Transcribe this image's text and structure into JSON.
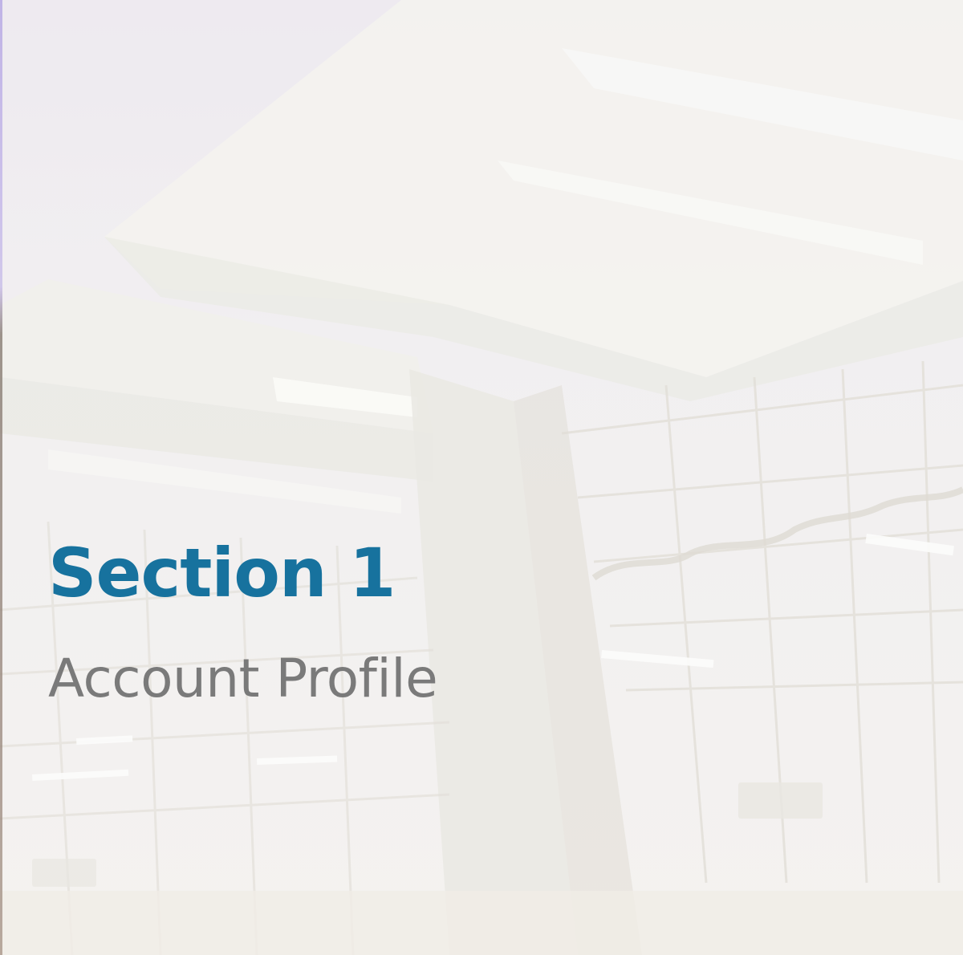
{
  "slide": {
    "title": "Section 1",
    "subtitle": "Account Profile",
    "background_image": "faded-airport-terminal-interior"
  },
  "colors": {
    "title": "#17729e",
    "subtitle": "#7a7a7a",
    "background": "#f3f1ee",
    "left_edge_accent": "#8f7ad6"
  }
}
